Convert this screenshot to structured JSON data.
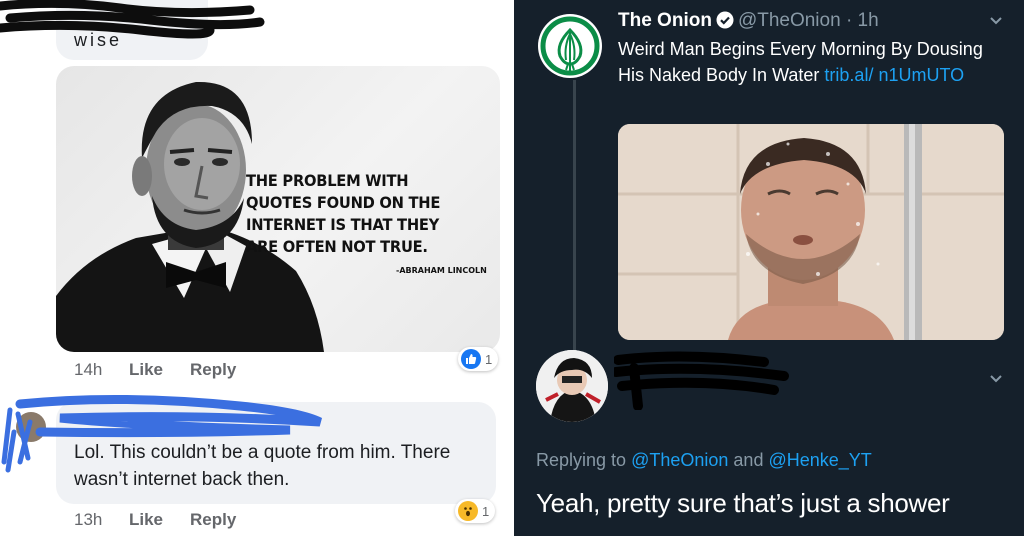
{
  "facebook": {
    "prev_comment_text": "wise",
    "quote_image": {
      "quote": "THE PROBLEM WITH QUOTES FOUND ON THE INTERNET IS THAT THEY ARE OFTEN NOT TRUE.",
      "author": "-ABRAHAM LINCOLN"
    },
    "comment1": {
      "time": "14h",
      "like_label": "Like",
      "reply_label": "Reply",
      "reaction_icon": "thumbs-up-icon",
      "reaction_count": "1"
    },
    "comment2": {
      "text": "Lol. This couldn’t be a quote from him. There wasn’t internet back then.",
      "time": "13h",
      "like_label": "Like",
      "reply_label": "Reply",
      "reaction_icon": "wow-face-icon",
      "reaction_count": "1"
    },
    "colors": {
      "reaction_blue": "#1877f2",
      "wow_yellow": "#f7b928",
      "scribble_blue": "#3b6fe0"
    }
  },
  "twitter": {
    "tweet": {
      "name": "The Onion",
      "verified_icon": "verified-badge-icon",
      "handle": "@TheOnion",
      "time": "· 1h",
      "text": "Weird Man Begins Every Morning By Dousing His Naked Body In Water ",
      "link": "trib.al/ n1UmUTO"
    },
    "reply": {
      "replying_prefix": "Replying to",
      "mention1": "@TheOnion",
      "joiner": "and",
      "mention2": "@Henke_YT",
      "text": "Yeah, pretty sure that’s just a shower"
    },
    "colors": {
      "background": "#15202b",
      "link": "#1da1f2",
      "muted": "#8899a6",
      "onion_green": "#0b8d47"
    }
  }
}
